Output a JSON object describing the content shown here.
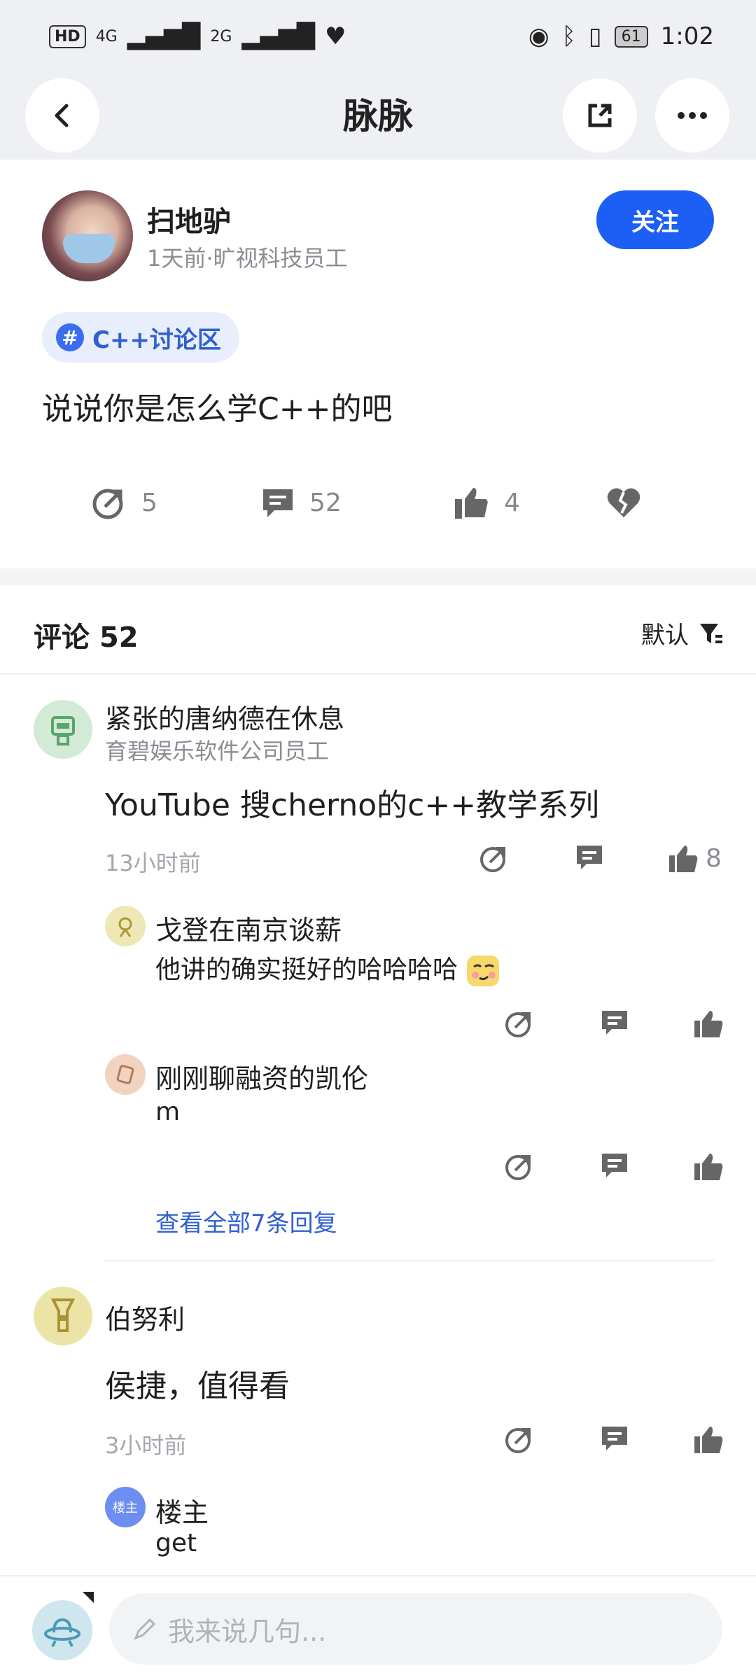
{
  "status": {
    "hd": "HD",
    "sig1": "4G",
    "sig2": "2G",
    "time": "1:02",
    "battery": "61"
  },
  "header": {
    "title": "脉脉"
  },
  "post": {
    "author": "扫地驴",
    "meta": "1天前·旷视科技员工",
    "follow_label": "关注",
    "topic": "C++讨论区",
    "text": "说说你是怎么学C++的吧",
    "share_count": "5",
    "comment_count": "52",
    "like_count": "4"
  },
  "comments_header": {
    "title": "评论",
    "count": "52",
    "sort_label": "默认"
  },
  "comments": [
    {
      "name": "紧张的唐纳德在休息",
      "company": "育碧娱乐软件公司员工",
      "text": "YouTube 搜cherno的c++教学系列",
      "time": "13小时前",
      "likes": "8",
      "replies": [
        {
          "name": "戈登在南京谈薪",
          "text": "他讲的确实挺好的哈哈哈哈"
        },
        {
          "name": "刚刚聊融资的凯伦",
          "text": "m"
        }
      ],
      "more_replies": "查看全部7条回复"
    },
    {
      "name": "伯努利",
      "text": "侯捷，值得看",
      "time": "3小时前",
      "replies": [
        {
          "name": "楼主",
          "badge": "楼主",
          "text": "get"
        }
      ]
    }
  ],
  "input": {
    "placeholder": "我来说几句..."
  },
  "colors": {
    "accent": "#1d5ff5",
    "link": "#2f5fd0",
    "background": "#eef0f4"
  }
}
